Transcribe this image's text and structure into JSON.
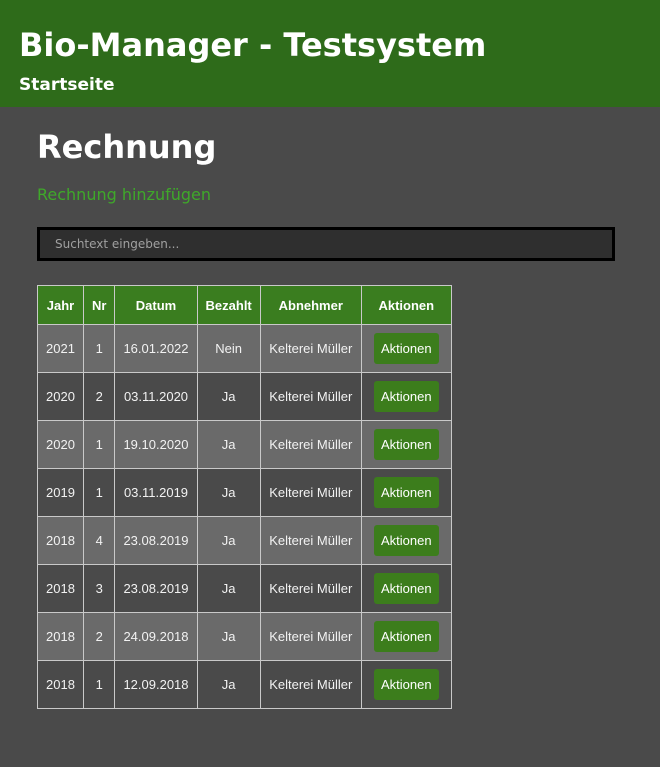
{
  "header": {
    "title": "Bio-Manager - Testsystem",
    "nav_link": "Startseite"
  },
  "main": {
    "page_title": "Rechnung",
    "add_link": "Rechnung hinzufügen",
    "search": {
      "placeholder": "Suchtext eingeben...",
      "value": ""
    },
    "table": {
      "headers": [
        "Jahr",
        "Nr",
        "Datum",
        "Bezahlt",
        "Abnehmer",
        "Aktionen"
      ],
      "rows": [
        {
          "jahr": "2021",
          "nr": "1",
          "datum": "16.01.2022",
          "bezahlt": "Nein",
          "abnehmer": "Kelterei Müller",
          "action": "Aktionen"
        },
        {
          "jahr": "2020",
          "nr": "2",
          "datum": "03.11.2020",
          "bezahlt": "Ja",
          "abnehmer": "Kelterei Müller",
          "action": "Aktionen"
        },
        {
          "jahr": "2020",
          "nr": "1",
          "datum": "19.10.2020",
          "bezahlt": "Ja",
          "abnehmer": "Kelterei Müller",
          "action": "Aktionen"
        },
        {
          "jahr": "2019",
          "nr": "1",
          "datum": "03.11.2019",
          "bezahlt": "Ja",
          "abnehmer": "Kelterei Müller",
          "action": "Aktionen"
        },
        {
          "jahr": "2018",
          "nr": "4",
          "datum": "23.08.2019",
          "bezahlt": "Ja",
          "abnehmer": "Kelterei Müller",
          "action": "Aktionen"
        },
        {
          "jahr": "2018",
          "nr": "3",
          "datum": "23.08.2019",
          "bezahlt": "Ja",
          "abnehmer": "Kelterei Müller",
          "action": "Aktionen"
        },
        {
          "jahr": "2018",
          "nr": "2",
          "datum": "24.09.2018",
          "bezahlt": "Ja",
          "abnehmer": "Kelterei Müller",
          "action": "Aktionen"
        },
        {
          "jahr": "2018",
          "nr": "1",
          "datum": "12.09.2018",
          "bezahlt": "Ja",
          "abnehmer": "Kelterei Müller",
          "action": "Aktionen"
        }
      ]
    }
  },
  "colors": {
    "header_bg": "#2e6b1a",
    "page_bg": "#4a4a4a",
    "accent_green": "#3fa82a",
    "table_header_bg": "#3a7d1f",
    "button_bg": "#3c7d1c"
  }
}
